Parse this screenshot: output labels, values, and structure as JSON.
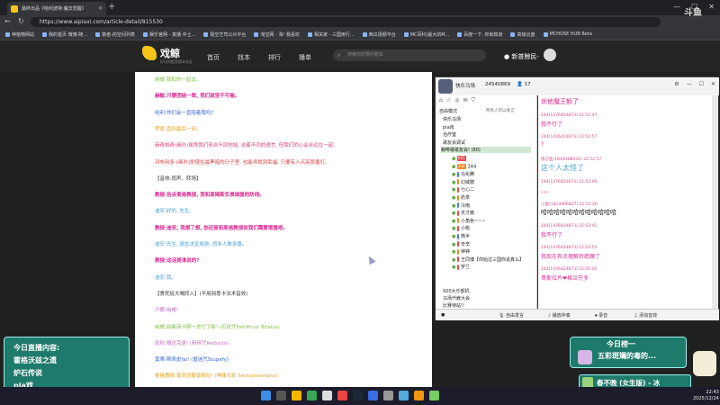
{
  "browser": {
    "tab_title": "最终出品《哈利波特:魔法觉醒》",
    "url": "https://www.aipiaxi.com/article-detail/815530",
    "bookmarks": [
      "种植物网站",
      "我的首页 微博-随...",
      "数者-的空间列表",
      "娱乐官网 - 真播 中土...",
      "极空艺司公众平台",
      "淘宝网 - 淘! 我喜欢",
      "相关家 - 三国用行...",
      "西瓜视频平台",
      "MC百科|最大的M...",
      "百度一下, 你就知道",
      "高级云盘",
      "MCHOSE HUB Beta"
    ]
  },
  "site": {
    "logo": "戏鲸",
    "logo_sub": "好玩的配音剧本社区",
    "nav": [
      "首页",
      "找本",
      "排行",
      "播单"
    ],
    "search_placeholder": "搜索你想要的剧本",
    "user_label": "新普鲸民-"
  },
  "article": {
    "lines": [
      {
        "text": "纳威:我和你一起去。",
        "color": "#7fbf40"
      },
      {
        "text": "赫敏:只要团结一致, 我们就坚不可摧。",
        "color": "#d9268f"
      },
      {
        "text": "哈利:你们会一直陪着我吗?",
        "color": "#3a62d6"
      },
      {
        "text": "罗恩:直到最后一刻。",
        "color": "#e0a020"
      },
      {
        "text": "赫奇帕奇(画外)虽然我们来自不同地域, 说着不同的语言, 但我们的心会永远在一起。",
        "color": "#e04080"
      },
      {
        "text": "邓布利多:(画外)即使在最黑暗的日子里, 也能寻找到幸福, 只要有人点亮那盏灯。",
        "color": "#e04040"
      },
      {
        "text": "【音效:雨声、转场】",
        "color": "#333333"
      },
      {
        "text": "教授:告诉麦格教授, 我和莱姆斯负责城堡的防线。",
        "color": "#d9268f"
      },
      {
        "text": "迪安:好的, 先生。",
        "color": "#4aa0d8"
      },
      {
        "text": "教授:迪安, 我想了想, 你还是和麦格教授说我们需要增援吧。",
        "color": "#d9268f"
      },
      {
        "text": "迪安:先生, 德念决定成败, 而非人数多寡。",
        "color": "#4aa0d8"
      },
      {
        "text": "教授:这话是谁说的?",
        "color": "#d9268f"
      },
      {
        "text": "迪安:我。",
        "color": "#4aa0d8"
      },
      {
        "text": "【食死徒大喊同入】(不用刻意卡法术音效)",
        "color": "#333333"
      },
      {
        "text": "卢娜:纳威!",
        "color": "#c070c0"
      },
      {
        "text": "纳威:给曲菲卡斯一进它了新! (石化咒Petrificus Totalus)",
        "color": "#7fbf40"
      },
      {
        "text": "张秋:隔达克速! (粉碎咒Reducto)",
        "color": "#c070c0"
      },
      {
        "text": "莫蒂:斯表皮fai! (昏迷咒Stupefy)",
        "color": "#3a62d6"
      },
      {
        "text": "麦格教授:普克班娜普敕拉! (神锋无影 Sectumsempra)",
        "color": "#e0a020"
      }
    ]
  },
  "stream": {
    "channel": "快乐马场",
    "room_id": "24540869",
    "fans": "17",
    "left_header": "自由模式",
    "left_header2": "所有人可以发言",
    "tree": [
      {
        "text": "快乐马场",
        "hl": false
      },
      {
        "text": "pia戏",
        "hl": false
      },
      {
        "text": "治疗室",
        "hl": false
      },
      {
        "text": "歌友会调试",
        "hl": false
      },
      {
        "text": "鲸啡歌歌友会! (80)",
        "hl": true
      }
    ],
    "members": [
      {
        "badge": "K25",
        "cls": "",
        "name": ""
      },
      {
        "badge": "244",
        "cls": "o",
        "name": "244"
      },
      {
        "badge": "",
        "cls": "b",
        "name": "马化腾"
      },
      {
        "badge": "",
        "cls": "o",
        "name": "幻域鹦"
      },
      {
        "badge": "",
        "cls": "",
        "name": "七心二"
      },
      {
        "badge": "",
        "cls": "o",
        "name": "奶茶"
      },
      {
        "badge": "",
        "cls": "b",
        "name": "冷雨"
      },
      {
        "badge": "",
        "cls": "",
        "name": "天才酱"
      },
      {
        "badge": "",
        "cls": "o",
        "name": "小角色~~~"
      },
      {
        "badge": "",
        "cls": "",
        "name": "小桃"
      },
      {
        "badge": "",
        "cls": "b",
        "name": "熊半"
      },
      {
        "badge": "",
        "cls": "",
        "name": "辛辛"
      },
      {
        "badge": "",
        "cls": "o",
        "name": "钟钟"
      },
      {
        "badge": "",
        "cls": "",
        "name": "王同博【你始过三国你说真么】"
      },
      {
        "badge": "",
        "cls": "",
        "name": "罗兰"
      }
    ],
    "tree_bottom": [
      "920大乐部机",
      "马场仟雇大会",
      "比赛待站!!"
    ],
    "chat": [
      {
        "head": "",
        "body": "优他魔王额了",
        "color": "#d9268f",
        "size": 7
      },
      {
        "head": "244(1476424873)  22:52:47",
        "body": "我不行了",
        "color": "#d9268f",
        "size": 6
      },
      {
        "head": "244(1476424873)  22:52:57",
        "body": "?",
        "color": "#d9268f",
        "size": 6
      },
      {
        "head": "饭小鱼(1849308034)  22:52:57",
        "body": "这个人太怪了",
        "color": "#4aa0d8",
        "size": 8
      },
      {
        "head": "244(1476424873)  22:53:06",
        "body": "。。。",
        "color": "#d9268f",
        "size": 6
      },
      {
        "head": "小鱼(1814966827)  22:53:26",
        "body": "哈哈哈哈哈哈哈哈哈哈哈哈",
        "color": "#222222",
        "size": 7
      },
      {
        "head": "244(1476424873)  22:53:41",
        "body": "我不行了",
        "color": "#d9268f",
        "size": 6
      },
      {
        "head": "244(1476424873)  22:53:53",
        "body": "我现在有点理解状绝魔了",
        "color": "#d9268f",
        "size": 6
      },
      {
        "head": "244(1476424873)  22:55:05",
        "body": "哥斯拉片❤格兰芬多",
        "color": "#d9268f",
        "size": 6
      }
    ],
    "bottom_buttons": [
      "自由发言",
      "播放伴奏",
      "录音",
      "添加音效"
    ]
  },
  "overlays": {
    "live_lines": [
      "今日直播内容:",
      "霍格沃兹之遗",
      "炉石传说",
      "pia戏"
    ],
    "rank_title": "今日榜一",
    "rank_name": "五彩斑斓的毒的...",
    "song": "春不晚 (女生版) - 冰",
    "platform": "斗鱼"
  },
  "taskbar": {
    "time": "22:43",
    "date": "2025/12/24"
  }
}
